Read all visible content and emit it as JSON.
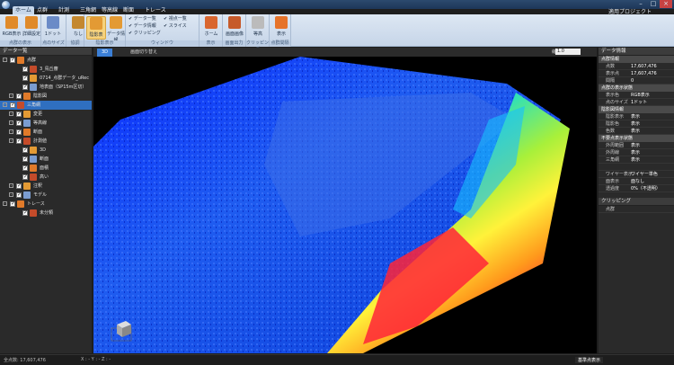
{
  "window": {
    "title": ""
  },
  "ribbon": {
    "tabs": [
      "ホーム",
      "点群",
      "計測",
      "三角網",
      "等高線",
      "断面",
      "トレース"
    ],
    "active_tab": 0,
    "help_link": "適用プロジェクト",
    "groups": [
      {
        "label": "点群の表示",
        "buttons": [
          "RGB表示",
          "詳細設定"
        ]
      },
      {
        "label": "点のサイズ",
        "buttons": [
          "1ドット"
        ]
      },
      {
        "label": "協調",
        "buttons": [
          "なし"
        ]
      },
      {
        "label": "陰影表示",
        "buttons": [
          "陰影表",
          "データ情報"
        ]
      },
      {
        "label": "ウィンドウ",
        "checks": [
          "データ一覧",
          "データ情報",
          "クリッピング",
          "視点一覧",
          "スライス"
        ]
      },
      {
        "label": "表示",
        "buttons": [
          "ホーム"
        ]
      },
      {
        "label": "画面出力",
        "buttons": [
          "画面画像"
        ]
      },
      {
        "label": "クリッピング",
        "buttons": [
          "等高"
        ]
      },
      {
        "label": "点群間隔",
        "buttons": [
          "表示"
        ]
      }
    ]
  },
  "left_panel": {
    "title": "データ一覧",
    "items": [
      {
        "label": "点群",
        "level": 0,
        "checked": true
      },
      {
        "label": "3_鳥丘審",
        "level": 2,
        "checked": true
      },
      {
        "label": "0714_点群データ_uRec",
        "level": 2,
        "checked": true
      },
      {
        "label": "地表面（SP15m区切）",
        "level": 2,
        "checked": true
      },
      {
        "label": "陰影図",
        "level": 1,
        "checked": true
      },
      {
        "label": "三角網",
        "level": 0,
        "checked": true,
        "selected": true
      },
      {
        "label": "変更",
        "level": 1,
        "checked": true
      },
      {
        "label": "等高線",
        "level": 1,
        "checked": true
      },
      {
        "label": "断面",
        "level": 1,
        "checked": true
      },
      {
        "label": "計測値",
        "level": 1,
        "checked": true
      },
      {
        "label": "3D",
        "level": 2,
        "checked": true
      },
      {
        "label": "断面",
        "level": 2,
        "checked": true
      },
      {
        "label": "面積",
        "level": 2,
        "checked": true
      },
      {
        "label": "高い",
        "level": 2,
        "checked": true
      },
      {
        "label": "注釈",
        "level": 1,
        "checked": true
      },
      {
        "label": "モデル",
        "level": 1,
        "checked": true
      },
      {
        "label": "トレース",
        "level": 0,
        "checked": true
      },
      {
        "label": "未分類",
        "level": 2,
        "checked": true
      }
    ]
  },
  "viewport": {
    "tabs": [
      "3D",
      "画面切り替え"
    ],
    "scale_label": "縮尺倍率",
    "scale_value": "1.0"
  },
  "right_panel": {
    "title": "データ情報",
    "sections": [
      {
        "title": "点群情報",
        "rows": [
          [
            "点数",
            "17,607,476"
          ],
          [
            "表示点",
            "17,607,476"
          ],
          [
            "間隔",
            "0"
          ]
        ]
      },
      {
        "title": "点群の表示状態",
        "rows": [
          [
            "表示色",
            "RGB表示"
          ],
          [
            "点のサイズ",
            "1ドット"
          ]
        ]
      },
      {
        "title": "陰影図情報",
        "rows": [
          [
            "陰影表示",
            "表示"
          ],
          [
            "陰影色",
            "表示"
          ],
          [
            "色数",
            "表示"
          ]
        ]
      },
      {
        "title": "不要点表示状態",
        "rows": [
          [
            "外周範囲",
            "表示"
          ],
          [
            "外周線",
            "表示"
          ],
          [
            "三角網",
            "表示"
          ],
          [
            "",
            ""
          ],
          [
            "ワイヤー表示",
            "ワイヤー単色"
          ],
          [
            "面表示",
            "面なし"
          ],
          [
            "透過度",
            "0%（不透明）"
          ]
        ]
      }
    ],
    "clip_title": "クリッピング",
    "clip_item": "点群"
  },
  "status": {
    "points": "全点数: 17,607,476",
    "coords": "X : - Y : - Z : -",
    "mode": "基準点表示"
  },
  "colors": {
    "accent": "#2f6fc0",
    "ribbon": "#d6e2f0"
  }
}
